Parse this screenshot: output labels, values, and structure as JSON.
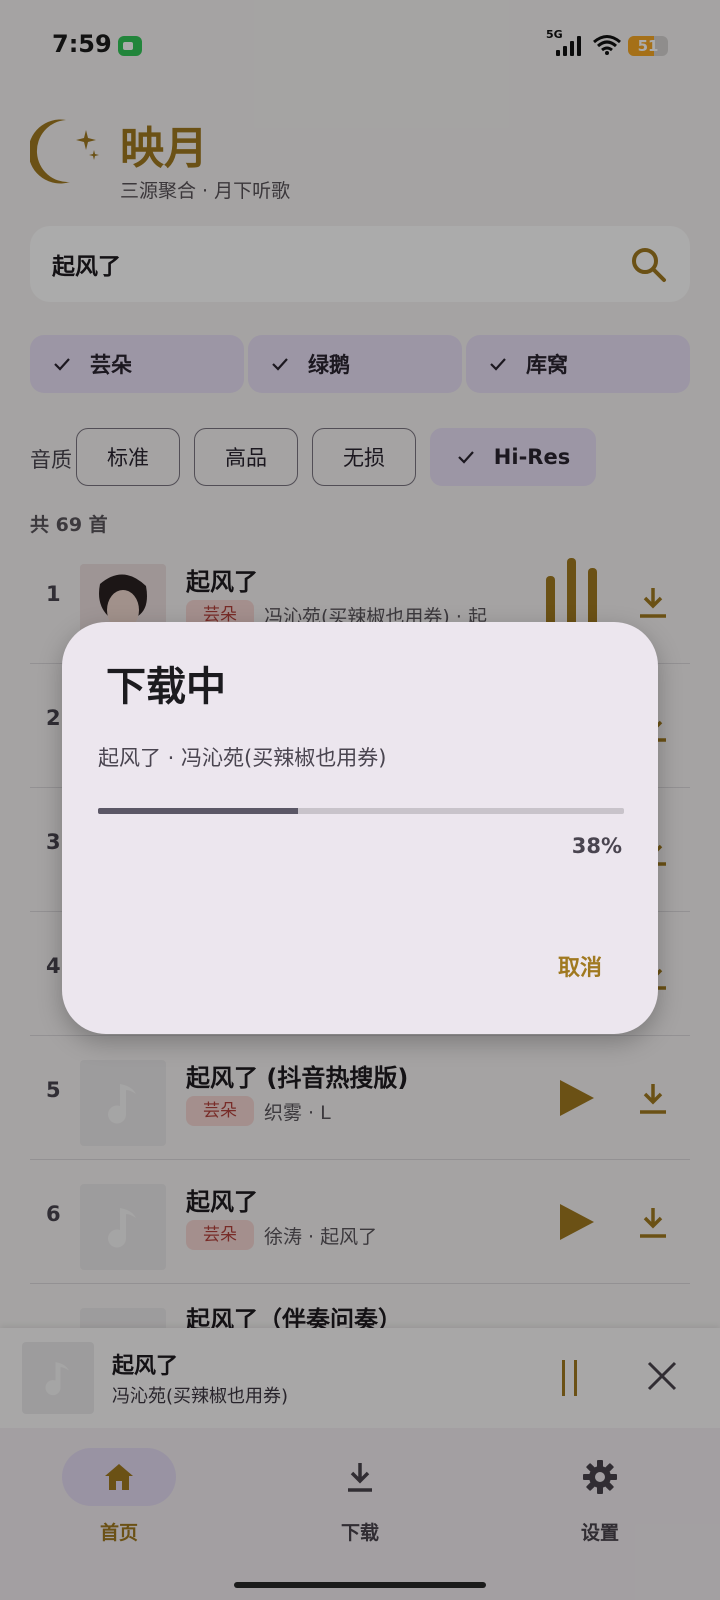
{
  "status": {
    "time": "7:59",
    "network": "5G",
    "wifi_sub": "6",
    "battery": "51"
  },
  "header": {
    "title": "映月",
    "subtitle": "三源聚合 · 月下听歌"
  },
  "search": {
    "value": "起风了"
  },
  "sources": [
    {
      "label": "芸朵",
      "checked": true
    },
    {
      "label": "绿鹅",
      "checked": true
    },
    {
      "label": "库窝",
      "checked": true
    }
  ],
  "quality": {
    "label": "音质",
    "options": [
      {
        "label": "标准",
        "selected": false
      },
      {
        "label": "高品",
        "selected": false
      },
      {
        "label": "无损",
        "selected": false
      },
      {
        "label": "Hi-Res",
        "selected": true
      }
    ]
  },
  "result_count": "共 69 首",
  "songs": [
    {
      "index": "1",
      "title": "起风了",
      "source": "芸朵",
      "meta": "冯沁苑(买辣椒也用券) · 起",
      "playing": true
    },
    {
      "index": "2",
      "title": "",
      "source": "",
      "meta": "",
      "playing": false
    },
    {
      "index": "3",
      "title": "",
      "source": "",
      "meta": "",
      "playing": false
    },
    {
      "index": "4",
      "title": "",
      "source": "",
      "meta": "",
      "playing": false
    },
    {
      "index": "5",
      "title": "起风了 (抖音热搜版)",
      "source": "芸朵",
      "meta": "织雾 · L",
      "playing": false
    },
    {
      "index": "6",
      "title": "起风了",
      "source": "芸朵",
      "meta": "徐涛 · 起风了",
      "playing": false
    },
    {
      "index": "",
      "title": "起风了（伴奏问奏）",
      "source": "",
      "meta": "",
      "playing": false
    }
  ],
  "mini_player": {
    "title": "起风了",
    "artist": "冯沁苑(买辣椒也用券)"
  },
  "nav": [
    {
      "label": "首页",
      "icon": "home-icon",
      "active": true
    },
    {
      "label": "下载",
      "icon": "download-icon",
      "active": false
    },
    {
      "label": "设置",
      "icon": "gear-icon",
      "active": false
    }
  ],
  "dialog": {
    "title": "下载中",
    "message": "起风了 · 冯沁苑(买辣椒也用券)",
    "progress": 0.38,
    "progress_text": "38%",
    "cancel_label": "取消"
  },
  "colors": {
    "accent": "#a07920",
    "chip_bg": "#e9e0f6",
    "badge_bg": "#f5d6d3",
    "badge_text": "#b3413b"
  }
}
